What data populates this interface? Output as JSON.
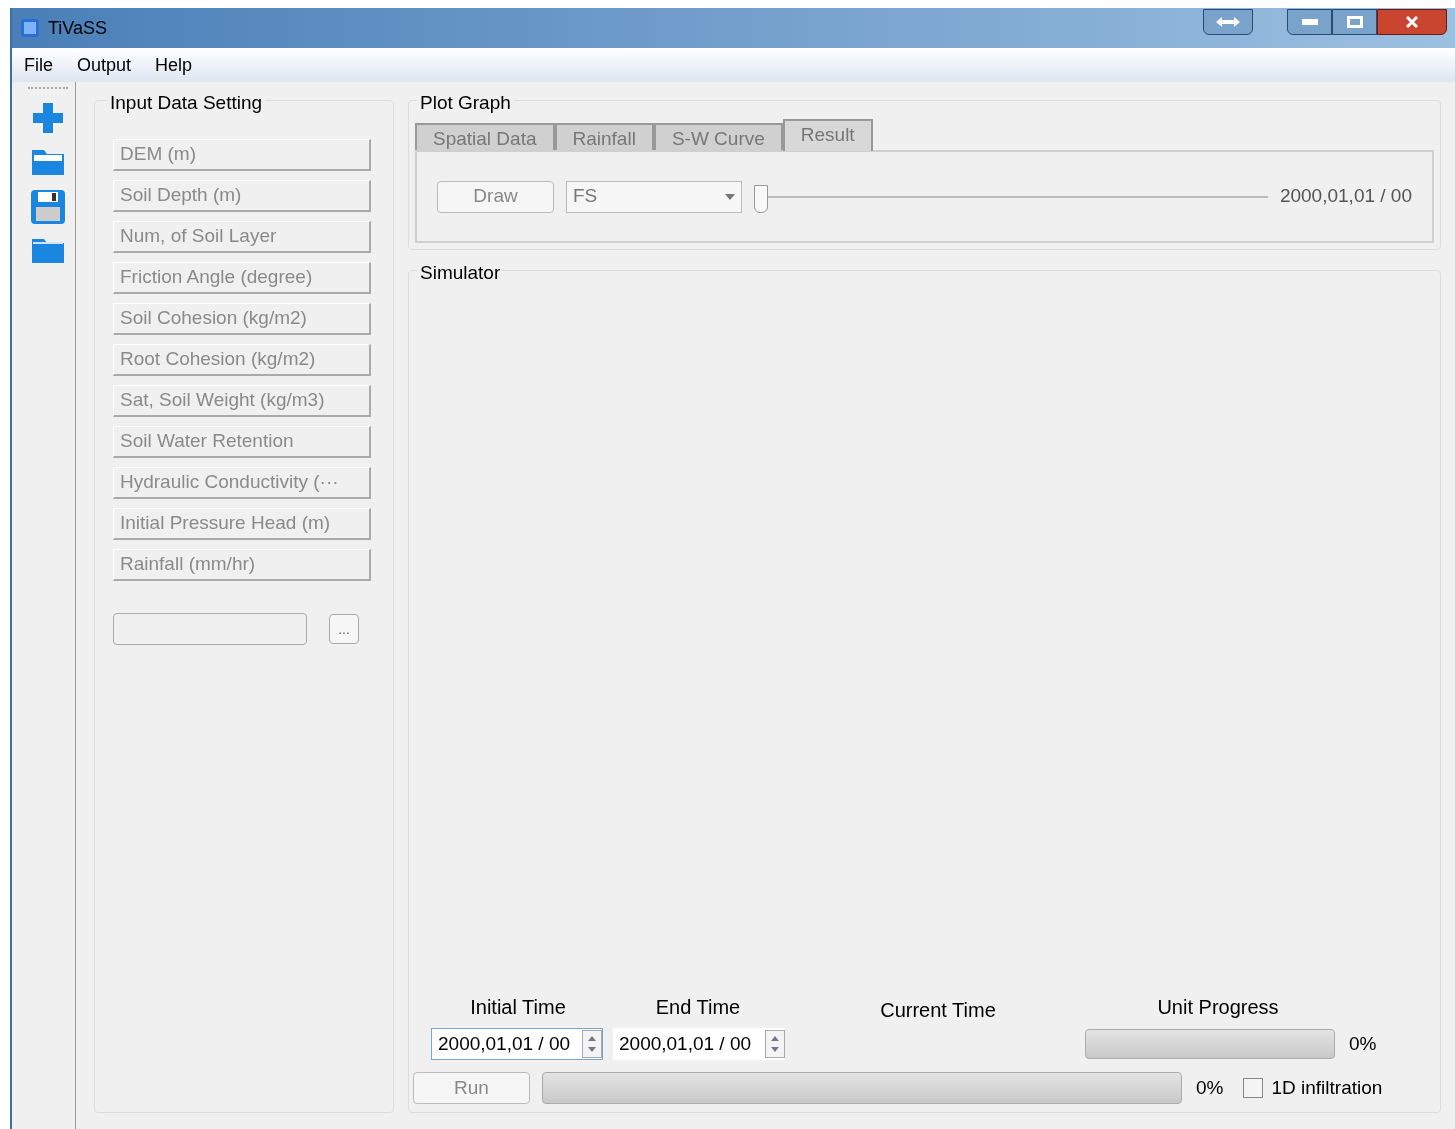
{
  "window": {
    "title": "TiVaSS"
  },
  "menu": [
    "File",
    "Output",
    "Help"
  ],
  "input_panel": {
    "title": "Input Data Setting",
    "buttons": [
      {
        "label": "DEM (m)",
        "disabled": true
      },
      {
        "label": "Soil Depth (m)",
        "disabled": true
      },
      {
        "label": "Num, of Soil Layer",
        "disabled": true
      },
      {
        "label": "Friction Angle (degree)",
        "disabled": true
      },
      {
        "label": "Soil Cohesion (kg/m2)",
        "disabled": true
      },
      {
        "label": "Root Cohesion (kg/m2)",
        "disabled": true
      },
      {
        "label": "Sat, Soil Weight (kg/m3)",
        "disabled": true
      },
      {
        "label": "Soil Water Retention",
        "disabled": true
      },
      {
        "label": "Hydraulic Conductivity (···",
        "disabled": true
      },
      {
        "label": "Initial Pressure Head (m)",
        "disabled": true
      },
      {
        "label": "Rainfall (mm/hr)",
        "disabled": true
      }
    ],
    "browse_button": "..."
  },
  "plot_graph": {
    "title": "Plot Graph",
    "tabs": [
      {
        "label": "Spatial Data",
        "selected": false
      },
      {
        "label": "Rainfall",
        "selected": false
      },
      {
        "label": "S-W Curve",
        "selected": false
      },
      {
        "label": "Result",
        "selected": true
      }
    ],
    "draw_button": {
      "label": "Draw",
      "disabled": true
    },
    "dropdown": "FS",
    "slider": {
      "level": 0
    },
    "time": "2000,01,01 / 00"
  },
  "simulator": {
    "title": "Simulator",
    "initial_time": {
      "label": "Initial Time",
      "value": "2000,01,01 / 00"
    },
    "end_time": {
      "label": "End Time",
      "value": "2000,01,01 / 00"
    },
    "current_time": {
      "label": "Current Time"
    },
    "unit_progress": {
      "label": "Unit Progress",
      "level": 0,
      "reading": "0%"
    },
    "run_button": {
      "label": "Run",
      "disabled": true
    },
    "total_progress": {
      "level": 0,
      "reading": "0%"
    },
    "infiltration": {
      "label": "1D infiltration",
      "checked": false
    }
  }
}
